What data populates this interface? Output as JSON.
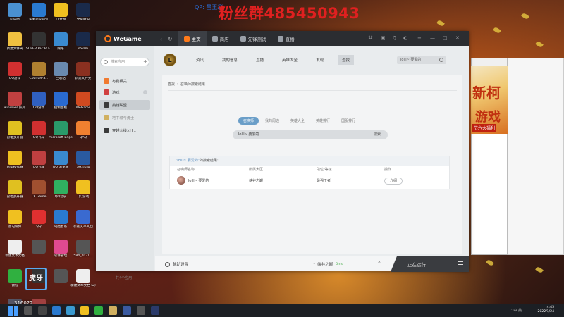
{
  "overlay": {
    "fan_group": "粉丝群485450943",
    "qq_prefix": "QP: 昌王彩",
    "faint": "Welcome to the Enterprise"
  },
  "desktop_icons": [
    {
      "label": "此电脑",
      "color": "#4a90d0"
    },
    {
      "label": "电脑驱动运行",
      "color": "#2a7ad0"
    },
    {
      "label": "YY开播",
      "color": "#f0c020"
    },
    {
      "label": "英雄联盟",
      "color": "#1a2a4a"
    },
    {
      "label": "新建文件夹",
      "color": "#f0c040"
    },
    {
      "label": "SUPER PEOPLE CBT",
      "color": "#333"
    },
    {
      "label": "网络",
      "color": "#3a8ad0"
    },
    {
      "label": "steam",
      "color": "#1a2a4a"
    },
    {
      "label": "QQ游戏",
      "color": "#d03030"
    },
    {
      "label": "Counter-S...",
      "color": "#b08030"
    },
    {
      "label": "回收站",
      "color": "#6a8ab0"
    },
    {
      "label": "新建文件夹",
      "color": "#8a3020"
    },
    {
      "label": "windows 照片",
      "color": "#c04040"
    },
    {
      "label": "QQ游戏",
      "color": "#3060c0"
    },
    {
      "label": "控制面板",
      "color": "#2a6ad0"
    },
    {
      "label": "WeGame",
      "color": "#d04a20"
    },
    {
      "label": "雷电多开器",
      "color": "#e0c020"
    },
    {
      "label": "QQ飞车",
      "color": "#d03030"
    },
    {
      "label": "Microsoft Edge",
      "color": "#2a9a6a"
    },
    {
      "label": "QAQ",
      "color": "#f08030"
    },
    {
      "label": "雷电模拟器",
      "color": "#f0c020"
    },
    {
      "label": "QQ飞车",
      "color": "#c04040"
    },
    {
      "label": "QQ 浏览器",
      "color": "#3a8ad0"
    },
    {
      "label": "游戏加加",
      "color": "#2a5aa0"
    },
    {
      "label": "雷电多开器",
      "color": "#e0c020"
    },
    {
      "label": "CF Game",
      "color": "#a05030"
    },
    {
      "label": "QQ音乐",
      "color": "#30b060"
    },
    {
      "label": "QQ游戏",
      "color": "#f0c020"
    },
    {
      "label": "雷电模拟",
      "color": "#f0c020"
    },
    {
      "label": "QQ",
      "color": "#e03030"
    },
    {
      "label": "电脑管家",
      "color": "#2a7ad0"
    },
    {
      "label": "新建文本文档",
      "color": "#3a6ad0"
    },
    {
      "label": "新建文本文档",
      "color": "#eee"
    },
    {
      "label": "",
      "color": "#555"
    },
    {
      "label": "软件管理",
      "color": "#e04a90"
    },
    {
      "label": "584_2021...",
      "color": "#555"
    },
    {
      "label": "微信",
      "color": "#30b040"
    },
    {
      "label": "",
      "color": "#333"
    },
    {
      "label": "",
      "color": "#555"
    },
    {
      "label": "新建文本文档 (2)",
      "color": "#eee"
    },
    {
      "label": "新建文本文档",
      "color": "#556"
    },
    {
      "label": "新红警",
      "color": "#a04040"
    }
  ],
  "wegame": {
    "brand": "WeGame",
    "tabs": [
      {
        "label": "主页",
        "active": true,
        "color": "#ff7a1a"
      },
      {
        "label": "商店",
        "active": false,
        "color": "#9aa0a8"
      },
      {
        "label": "先锋测试",
        "active": false,
        "color": "#9aa0a8"
      },
      {
        "label": "直播",
        "active": false,
        "color": "#9aa0a8"
      }
    ],
    "sidebar": {
      "search_placeholder": "搜索应用",
      "items": [
        {
          "label": "与我相关",
          "color": "#f07a30",
          "selected": false,
          "dim": false
        },
        {
          "label": "游戏",
          "color": "#d04040",
          "selected": false,
          "dim": false
        },
        {
          "label": "英雄联盟",
          "color": "#3a3a3a",
          "selected": true,
          "dim": false
        },
        {
          "label": "地下城与勇士",
          "color": "#d0b060",
          "selected": false,
          "dim": true
        },
        {
          "label": "穿越火线×H...",
          "color": "#3a3a3a",
          "selected": false,
          "dim": false
        }
      ],
      "footer": "共4个应用"
    },
    "lol": {
      "logo_letter": "L",
      "tabs": [
        {
          "label": "资讯",
          "active": false
        },
        {
          "label": "我的信息",
          "active": false
        },
        {
          "label": "直播",
          "active": false
        },
        {
          "label": "英雄大全",
          "active": false
        },
        {
          "label": "发现",
          "active": false
        },
        {
          "label": "查找",
          "active": true
        }
      ],
      "search_value": "lolll~ 要爱的"
    },
    "breadcrumb": [
      "查找",
      "召唤师搜索结果"
    ],
    "sub_tabs": [
      {
        "label": "召唤师",
        "active": true
      },
      {
        "label": "我的周边",
        "active": false
      },
      {
        "label": "英雄大全",
        "active": false
      },
      {
        "label": "英雄排行",
        "active": false
      },
      {
        "label": "国服排行",
        "active": false
      }
    ],
    "search_query": "lolll~ 要爱的",
    "search_button": "搜索",
    "results": {
      "title_keyword": "\"lolll~ 要爱的\"",
      "title_suffix": "的搜索结果:",
      "headers": [
        "召唤师名称",
        "所属大区",
        "段位/等级",
        "操作"
      ],
      "rows": [
        {
          "name": "lolll~ 要爱的",
          "region": "峡谷之巅",
          "rank": "最强王者",
          "action": "介绍"
        }
      ]
    },
    "bottom": {
      "assist": "辅助设置",
      "server": "峡谷之巅",
      "ping": "5ms",
      "running": "正在运行..."
    }
  },
  "right_ad": {
    "line1": "新柯",
    "line2": "游戏",
    "line3": "节六大福利"
  },
  "watermark": {
    "text": "虎牙",
    "number": "316022"
  },
  "taskbar": {
    "time": "4:45",
    "date": "2022/1/24",
    "tray": "^ 中 英"
  }
}
